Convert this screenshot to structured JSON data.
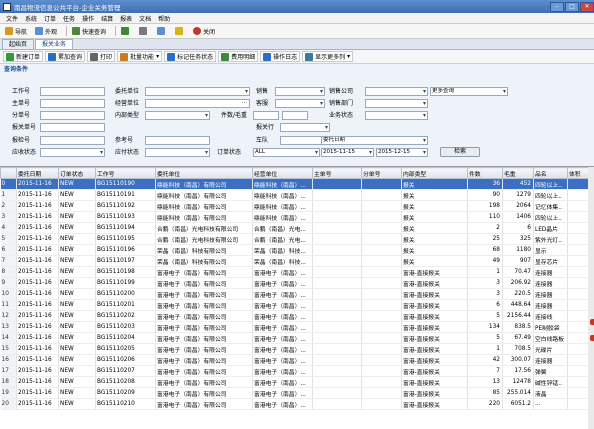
{
  "window": {
    "title": "南昌物流信息公共平台-企业关务管理"
  },
  "menu": [
    "文件",
    "系统",
    "订单",
    "任务",
    "操作",
    "结算",
    "报表",
    "文档",
    "帮助"
  ],
  "toolbar": [
    {
      "label": "导航",
      "icon": "navigate-icon",
      "color": "#d99a1c"
    },
    {
      "label": "外观",
      "icon": "appearance-icon",
      "color": "#5a8fd6"
    },
    {
      "label": "快速查询",
      "icon": "quick-search-icon",
      "color": "#4a8a3a"
    },
    {
      "label": "关闭",
      "icon": "close-icon",
      "color": "#c03b2b"
    }
  ],
  "tabs": [
    "起始页",
    "报关业务"
  ],
  "actions": [
    {
      "label": "新建订单",
      "icon": "add-icon",
      "color": "#2f9b3a"
    },
    {
      "label": "累加查询",
      "icon": "search-icon",
      "color": "#2b6cc4"
    },
    {
      "label": "打印",
      "icon": "print-icon",
      "color": "#666666"
    },
    {
      "label": "批量功能",
      "icon": "batch-icon",
      "color": "#d07a1a"
    },
    {
      "label": "标记任务状态",
      "icon": "flag-icon",
      "color": "#2b6cc4"
    },
    {
      "label": "费用明细",
      "icon": "money-icon",
      "color": "#3a8a3a"
    },
    {
      "label": "操作日志",
      "icon": "log-icon",
      "color": "#2b6cc4"
    },
    {
      "label": "显示更多列",
      "icon": "columns-icon",
      "color": "#3a7a9a"
    }
  ],
  "query": {
    "title": "查询条件",
    "labels": {
      "work_no": "工作号",
      "main_no": "主单号",
      "sub_no": "分单号",
      "customs_no": "报关单号",
      "inspection_no": "报检号",
      "receivable": "应收状态",
      "client": "委托单位",
      "operator_unit": "经营单位",
      "internal_type": "内部类型",
      "ref_no": "参考号",
      "payable": "应付状态",
      "sales": "销售",
      "customer_service": "客服",
      "pieces_weight": "件数/毛重",
      "customs_line": "报关行",
      "fleet": "车队",
      "order_status": "订单状态",
      "sales_company": "销售公司",
      "sales_dept": "销售部门",
      "business_status": "业务状态"
    },
    "more_query": "更多查询",
    "order_status_value": "ALL",
    "date_type": "委托日期",
    "date_from": "2015-11-15",
    "date_to": "2015-12-15",
    "search_button": "检索"
  },
  "table": {
    "columns": [
      "",
      "委托日期",
      "订单状态",
      "工作号",
      "委托单位",
      "经营单位",
      "主单号",
      "分单号",
      "内部类型",
      "件数",
      "毛重",
      "品名",
      "体积"
    ],
    "rows": [
      [
        "0",
        "2015-11-16",
        "NEW",
        "BG15110190",
        "鼎能科技（南昌）有限公司",
        "鼎能科技（南昌）...",
        "",
        "",
        "报关",
        "36",
        "452",
        "四轮以上..",
        ""
      ],
      [
        "1",
        "2015-11-16",
        "NEW",
        "BG15110191",
        "鼎能科技（南昌）有限公司",
        "鼎能科技（南昌）...",
        "",
        "",
        "报关",
        "90",
        "1279",
        "四轮以上..",
        ""
      ],
      [
        "2",
        "2015-11-16",
        "NEW",
        "BG15110192",
        "鼎能科技（南昌）有限公司",
        "鼎能科技（南昌）...",
        "",
        "",
        "报关",
        "198",
        "2064",
        "记忆体集..",
        ""
      ],
      [
        "3",
        "2015-11-16",
        "NEW",
        "BG15110193",
        "鼎能科技（南昌）有限公司",
        "鼎能科技（南昌）...",
        "",
        "",
        "报关",
        "110",
        "1406",
        "四轮以上..",
        ""
      ],
      [
        "4",
        "2015-11-16",
        "NEW",
        "BG15110194",
        "合鹏（南昌）光电科技有限公司",
        "合鹏（南昌）光电...",
        "",
        "",
        "报关",
        "2",
        "6",
        "LED晶片",
        ""
      ],
      [
        "5",
        "2015-11-16",
        "NEW",
        "BG15110195",
        "合鹏（南昌）光电科技有限公司",
        "合鹏（南昌）光电...",
        "",
        "",
        "报关",
        "25",
        "325",
        "紫外光灯..",
        ""
      ],
      [
        "6",
        "2015-11-16",
        "NEW",
        "BG15110196",
        "荣晶（南昌）科技有限公司",
        "荣晶（南昌）科技...",
        "",
        "",
        "报关",
        "68",
        "1180",
        "显示",
        ""
      ],
      [
        "7",
        "2015-11-16",
        "NEW",
        "BG15110197",
        "荣晶（南昌）科技有限公司",
        "荣晶（南昌）科技...",
        "",
        "",
        "报关",
        "49",
        "907",
        "显存芯片",
        ""
      ],
      [
        "8",
        "2015-11-16",
        "NEW",
        "BG15110198",
        "富港电子（南昌）有限公司",
        "富港电子（南昌）...",
        "",
        "",
        "富港-直接报关",
        "1",
        "70.47",
        "连接器",
        ""
      ],
      [
        "9",
        "2015-11-16",
        "NEW",
        "BG15110199",
        "富港电子（南昌）有限公司",
        "富港电子（南昌）...",
        "",
        "",
        "富港-直接报关",
        "3",
        "206.92",
        "连接器",
        ""
      ],
      [
        "10",
        "2015-11-16",
        "NEW",
        "BG15110200",
        "富港电子（南昌）有限公司",
        "富港电子（南昌）...",
        "",
        "",
        "富港-直接报关",
        "3",
        "220.5",
        "连接器",
        ""
      ],
      [
        "11",
        "2015-11-16",
        "NEW",
        "BG15110201",
        "富港电子（南昌）有限公司",
        "富港电子（南昌）...",
        "",
        "",
        "富港-直接报关",
        "6",
        "448.64",
        "连接器",
        ""
      ],
      [
        "12",
        "2015-11-16",
        "NEW",
        "BG15110202",
        "富港电子（南昌）有限公司",
        "富港电子（南昌）...",
        "",
        "",
        "富港-直接报关",
        "5",
        "2156.44",
        "连接线",
        ""
      ],
      [
        "13",
        "2015-11-16",
        "NEW",
        "BG15110203",
        "富港电子（南昌）有限公司",
        "富港电子（南昌）...",
        "",
        "",
        "富港-直接报关",
        "134",
        "838.5",
        "PE制胶袋",
        ""
      ],
      [
        "14",
        "2015-11-16",
        "NEW",
        "BG15110204",
        "富港电子（南昌）有限公司",
        "富港电子（南昌）...",
        "",
        "",
        "富港-直接报关",
        "5",
        "67.49",
        "空白线路板",
        ""
      ],
      [
        "15",
        "2015-11-16",
        "NEW",
        "BG15110205",
        "富港电子（南昌）有限公司",
        "富港电子（南昌）...",
        "",
        "",
        "富港-直接报关",
        "1",
        "708.5",
        "光碟片",
        ""
      ],
      [
        "16",
        "2015-11-16",
        "NEW",
        "BG15110206",
        "富港电子（南昌）有限公司",
        "富港电子（南昌）...",
        "",
        "",
        "富港-直接报关",
        "42",
        "300.07",
        "连接器",
        ""
      ],
      [
        "17",
        "2015-11-16",
        "NEW",
        "BG15110207",
        "富港电子（南昌）有限公司",
        "富港电子（南昌）...",
        "",
        "",
        "富港-直接报关",
        "7",
        "17.56",
        "弹簧",
        ""
      ],
      [
        "18",
        "2015-11-16",
        "NEW",
        "BG15110208",
        "富港电子（南昌）有限公司",
        "富港电子（南昌）...",
        "",
        "",
        "富港-直接报关",
        "13",
        "12478",
        "碱性锌锰..",
        ""
      ],
      [
        "19",
        "2015-11-16",
        "NEW",
        "BG15110209",
        "富港电子（南昌）有限公司",
        "富港电子（南昌）...",
        "",
        "",
        "富港-直接报关",
        "85",
        "255.014",
        "液晶",
        ""
      ],
      [
        "20",
        "2015-11-16",
        "NEW",
        "BG15110210",
        "富港电子（南昌）有限公司",
        "富港电子（南昌）...",
        "",
        "",
        "富港-直接报关",
        "220",
        "6051.2",
        "...",
        ""
      ]
    ]
  }
}
